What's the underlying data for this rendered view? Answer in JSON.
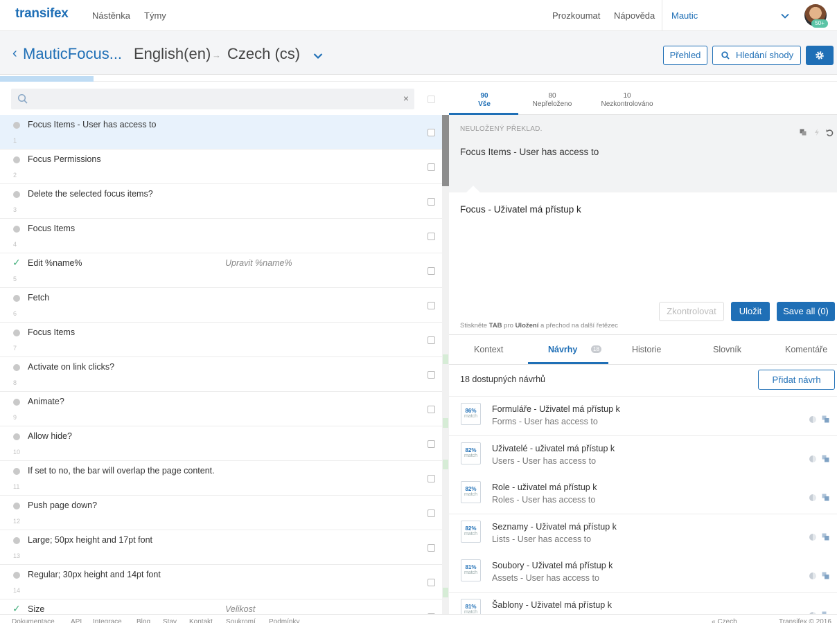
{
  "nav": {
    "logo": "transifex",
    "links": [
      "Nástěnka",
      "Týmy"
    ],
    "right_links": [
      "Prozkoumat",
      "Nápověda"
    ],
    "project": "Mautic",
    "avatar_badge": "50+"
  },
  "header": {
    "back": "‹",
    "project": "MauticFocus...",
    "source_lang": "English(en)",
    "arrow": "→",
    "target_lang": "Czech (cs)",
    "overview_btn": "Přehled",
    "find_btn": "Hledání shody"
  },
  "progress": {
    "translated_fraction": 0.112
  },
  "search": {
    "placeholder": "",
    "clear": "×"
  },
  "filter_tabs": [
    {
      "count": "90",
      "label": "Vše"
    },
    {
      "count": "80",
      "label": "Nepřeloženo"
    },
    {
      "count": "10",
      "label": "Nezkontrolováno"
    }
  ],
  "strings": [
    {
      "num": "1",
      "source": "Focus Items - User has access to",
      "translation": "",
      "translated": false,
      "selected": true
    },
    {
      "num": "2",
      "source": "Focus Permissions",
      "translation": "",
      "translated": false
    },
    {
      "num": "3",
      "source": "Delete the selected focus items?",
      "translation": "",
      "translated": false
    },
    {
      "num": "4",
      "source": "Focus Items",
      "translation": "",
      "translated": false
    },
    {
      "num": "5",
      "source": "Edit %name%",
      "translation": "Upravit %name%",
      "translated": true
    },
    {
      "num": "6",
      "source": "Fetch",
      "translation": "",
      "translated": false
    },
    {
      "num": "7",
      "source": "Focus Items",
      "translation": "",
      "translated": false
    },
    {
      "num": "8",
      "source": "Activate on link clicks?",
      "translation": "",
      "translated": false
    },
    {
      "num": "9",
      "source": "Animate?",
      "translation": "",
      "translated": false
    },
    {
      "num": "10",
      "source": "Allow hide?",
      "translation": "",
      "translated": false
    },
    {
      "num": "11",
      "source": "If set to no, the bar will overlap the page content.",
      "translation": "",
      "translated": false
    },
    {
      "num": "12",
      "source": "Push page down?",
      "translation": "",
      "translated": false
    },
    {
      "num": "13",
      "source": "Large; 50px height and 17pt font",
      "translation": "",
      "translated": false
    },
    {
      "num": "14",
      "source": "Regular; 30px height and 14pt font",
      "translation": "",
      "translated": false
    },
    {
      "num": "15",
      "source": "Size",
      "translation": "Velikost",
      "translated": true
    }
  ],
  "editor": {
    "unsaved_label": "NEULOŽENÝ PŘEKLAD.",
    "source_text": "Focus Items - User has access to",
    "translation_text": "Focus - Uživatel má přístup k",
    "review_btn": "Zkontrolovat",
    "save_btn": "Uložit",
    "save_all_btn": "Save all (0)",
    "hint_pre": "Stiskněte ",
    "hint_key": "TAB",
    "hint_mid": " pro ",
    "hint_action": "Uložení",
    "hint_post": " a přechod na další řetězec"
  },
  "bottom_tabs": {
    "context": "Kontext",
    "suggestions": "Návrhy",
    "suggestions_count": "18",
    "history": "Historie",
    "glossary": "Slovník",
    "comments": "Komentáře"
  },
  "suggestions_header": {
    "count_text": "18 dostupných návrhů",
    "add_btn": "Přidat návrh"
  },
  "suggestions": [
    {
      "pct": "86%",
      "match": "match",
      "translation": "Formuláře - Uživatel má přístup k",
      "source": "Forms - User has access to"
    },
    {
      "pct": "82%",
      "match": "match",
      "translation": "Uživatelé - uživatel má přístup k",
      "source": "Users - User has access to"
    },
    {
      "pct": "82%",
      "match": "match",
      "translation": "Role - uživatel má přístup k",
      "source": "Roles - User has access to"
    },
    {
      "pct": "82%",
      "match": "match",
      "translation": "Seznamy - Uživatel má přístup k",
      "source": "Lists - User has access to"
    },
    {
      "pct": "81%",
      "match": "match",
      "translation": "Soubory - Uživatel má přístup k",
      "source": "Assets - User has access to"
    },
    {
      "pct": "81%",
      "match": "match",
      "translation": "Šablony - Uživatel má přístup k",
      "source": ""
    }
  ],
  "footer": {
    "links": [
      "Dokumentace",
      "API",
      "Integrace",
      "Blog",
      "Stav",
      "Kontakt",
      "Soukromí",
      "Podmínky"
    ],
    "language": "« Czech",
    "copyright": "Transifex © 2016"
  }
}
